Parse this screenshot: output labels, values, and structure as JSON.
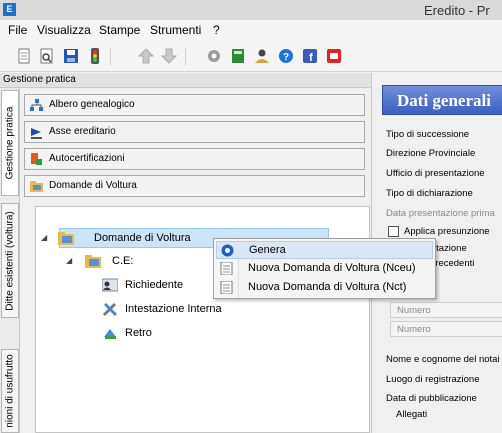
{
  "window": {
    "title": "Eredito - Pr",
    "app_icon_letter": "E"
  },
  "menu": [
    "File",
    "Visualizza",
    "Stampe",
    "Strumenti",
    "?"
  ],
  "toolbar": {
    "buttons": [
      "new-icon",
      "search-icon",
      "save-icon",
      "traffic-light-icon",
      "up-arrow-icon",
      "down-arrow-icon",
      "settings-icon",
      "calculator-icon",
      "users-icon",
      "help-icon",
      "facebook-icon",
      "youtube-icon"
    ]
  },
  "gestione_pratica": {
    "header": "Gestione pratica"
  },
  "vertical_tabs": [
    "Gestione pratica",
    "Ditte esistenti (voltura)",
    "nioni di usufrutto"
  ],
  "accordion": [
    {
      "label": "Albero genealogico",
      "icon": "tree-icon"
    },
    {
      "label": "Asse ereditario",
      "icon": "scale-icon"
    },
    {
      "label": "Autocertificazioni",
      "icon": "certificate-icon"
    },
    {
      "label": "Domande di Voltura",
      "icon": "folder-icon"
    }
  ],
  "tree": {
    "root": {
      "label": "Domande di Voltura",
      "expanded": true,
      "selected": true
    },
    "children": [
      {
        "label": "C.E:",
        "expanded": true,
        "children": [
          {
            "label": "Richiedente",
            "icon": "person-card-icon"
          },
          {
            "label": "Intestazione Interna",
            "icon": "tools-icon"
          },
          {
            "label": "Retro",
            "icon": "retro-icon"
          }
        ]
      }
    ]
  },
  "context_menu": [
    {
      "label": "Genera",
      "icon": "generate-icon",
      "highlighted": true
    },
    {
      "label": "Nuova Domanda di Voltura (Nceu)",
      "icon": "document-icon",
      "highlighted": false
    },
    {
      "label": "Nuova Domanda di Voltura (Nct)",
      "icon": "document-icon",
      "highlighted": false
    }
  ],
  "dati_generali": {
    "title": "Dati generali",
    "fields": [
      "Tipo di successione",
      "Direzione Provinciale",
      "Ufficio di presentazione",
      "Tipo di dichiarazione",
      "Data presentazione prima",
      "Applica presunzione",
      "itazione",
      "precedenti",
      "Numero",
      "Numero",
      "Nome e cognome del notai",
      "Luogo di registrazione",
      "Data di pubblicazione",
      "Allegati"
    ]
  },
  "colors": {
    "header_blue": "#3c5fbf",
    "selection": "#cce4f7",
    "menu_highlight": "#d9e6f5"
  }
}
